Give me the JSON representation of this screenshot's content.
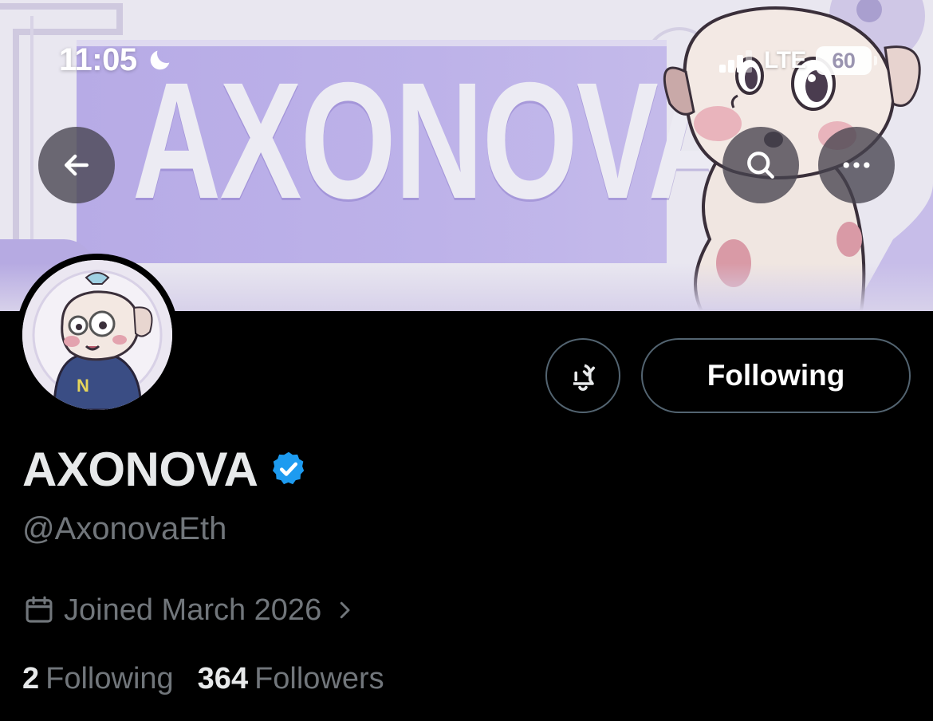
{
  "status_bar": {
    "time": "11:05",
    "network": "LTE",
    "battery": "60"
  },
  "banner": {
    "wordmark": "AXONOVA",
    "background_color": "#e8e6ef",
    "panel_color": "#b8ace6"
  },
  "nav": {
    "back_icon": "arrow-left-icon",
    "search_icon": "search-icon",
    "more_icon": "more-horizontal-icon"
  },
  "actions": {
    "notifications_icon": "bell-check-icon",
    "follow_button_label": "Following"
  },
  "profile": {
    "display_name": "AXONOVA",
    "verified": true,
    "handle": "@AxonovaEth",
    "joined": "Joined March 2026",
    "following_count": "2",
    "following_label": "Following",
    "followers_count": "364",
    "followers_label": "Followers"
  },
  "colors": {
    "background": "#000000",
    "primary_text": "#e7e9ea",
    "secondary_text": "#71767b",
    "verified_blue": "#1d9bf0",
    "button_border": "#536471"
  }
}
